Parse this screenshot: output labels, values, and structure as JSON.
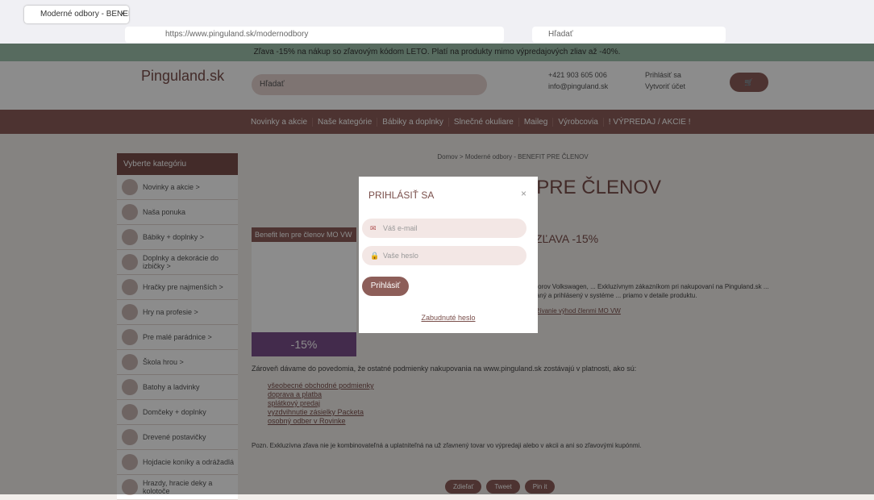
{
  "browser": {
    "tab_title": "Moderné odbory - BENEFIT PR",
    "url": "https://www.pinguland.sk/modernodbory",
    "search_placeholder": "Hľadať"
  },
  "promo": "Zľava -15% na nákup so zľavovým kódom LETO. Platí na produkty mimo výpredajových zliav až -40%.",
  "header": {
    "logo": "Pinguland.sk",
    "search_placeholder": "Hľadať",
    "phone": "+421 903 605 006",
    "email": "info@pinguland.sk",
    "login": "Prihlásiť sa",
    "create_account": "Vytvoriť účet"
  },
  "nav": [
    "Novinky a akcie",
    "Naše kategórie",
    "Bábiky a doplnky",
    "Slnečné okuliare",
    "Maileg",
    "Výrobcovia",
    "! VÝPREDAJ / AKCIE !"
  ],
  "sidebar": {
    "title": "Vyberte kategóriu",
    "items": [
      "Novinky a akcie >",
      "Naša ponuka",
      "Bábiky + doplnky >",
      "Doplnky a dekorácie do izbičky >",
      "Hračky pre najmenších >",
      "Hry na profesie >",
      "Pre malé parádnice >",
      "Škola hrou >",
      "Batohy a ladvinky",
      "Domčeky + doplnky",
      "Drevené postavičky",
      "Hojdacie koníky a odrážadlá",
      "Hrazdy, hracie deky a kolotoče"
    ]
  },
  "main": {
    "breadcrumb": "Domov > Moderné odbory - BENEFIT PRE ČLENOV",
    "title": "BENEFIT PRE ČLENOV",
    "subtitle": "ZĽAVA -15%",
    "banner_top": "Benefit len pre členov MO VW",
    "banner_percent": "-15%",
    "body": "Moderných odborov Volkswagen, ... Exkluzívnym zákazníkom pri nakupovaní na Pinguland.sk ... byť zaregistrovaný a prihlásený v systéme ... priamo v detaile produktu.",
    "link": "Postup pre využívanie výhod členmi MO VW",
    "conditions_intro": "Zároveň dávame do povedomia, že ostatné podmienky nakupovania na www.pinguland.sk zostávajú v platnosti, ako sú:",
    "conditions": [
      "všeobecné obchodné podmienky",
      "doprava a platba",
      "splátkový predaj",
      "vyzdvihnutie zásielky Packeta",
      "osobný odber v Rovinke"
    ],
    "note": "Pozn. Exkluzívna zľava nie je kombinovateľná a uplatniteľná na už zľavnený tovar vo výpredaji alebo v akcii a ani so zľavovými kupónmi.",
    "share": [
      "Zdieľať",
      "Tweet",
      "Pin it"
    ]
  },
  "modal": {
    "title": "PRIHLÁSIŤ SA",
    "close": "×",
    "email_placeholder": "Váš e-mail",
    "password_placeholder": "Vaše heslo",
    "login_button": "Prihlásiť",
    "forgot": "Zabudnuté heslo"
  }
}
